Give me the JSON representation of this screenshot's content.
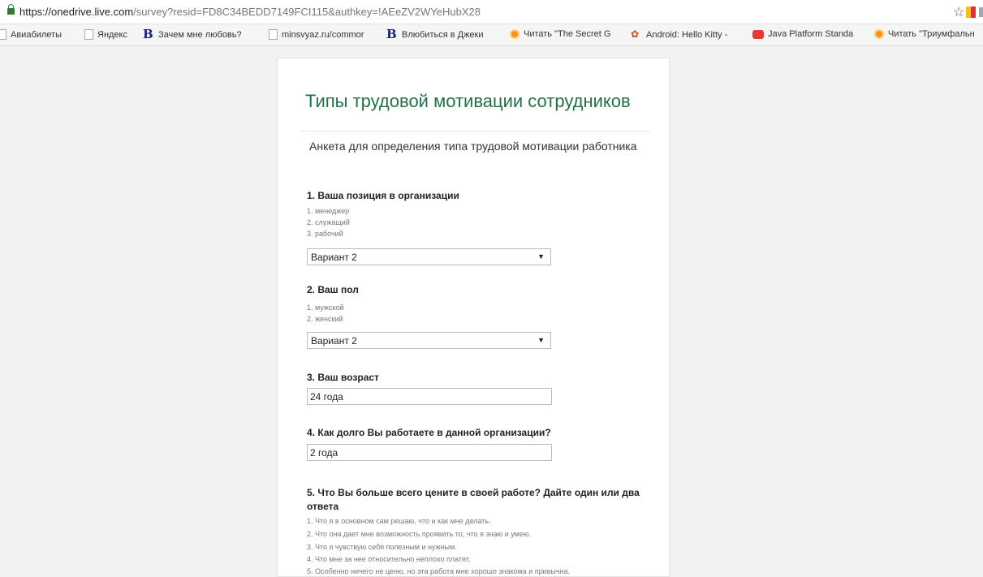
{
  "browser": {
    "url_host": "https://onedrive.live.com",
    "url_rest": "/survey?resid=FD8C34BEDD7149FCI115&authkey=!AEeZV2WYeHubX28",
    "bookmarks": [
      {
        "label": "Авиабилеты",
        "icon": "page-icon"
      },
      {
        "label": "Яндекс",
        "icon": "page-icon"
      },
      {
        "label": "Зачем мне любовь?",
        "icon": "b-icon"
      },
      {
        "label": "minsvyaz.ru/commor",
        "icon": "page-icon"
      },
      {
        "label": "Влюбиться в Джеки",
        "icon": "b-icon"
      },
      {
        "label": "Читать \"The Secret G",
        "icon": "orange-circle-icon"
      },
      {
        "label": "Android: Hello Kitty -",
        "icon": "paw-icon"
      },
      {
        "label": "Java Platform Standa",
        "icon": "java-icon"
      },
      {
        "label": "Читать \"Триумфальн",
        "icon": "orange-circle-icon"
      }
    ]
  },
  "survey": {
    "title": "Типы трудовой мотивации сотрудников",
    "subtitle": "Анкета для определения типа трудовой мотивации работника",
    "q1": {
      "label": "1. Ваша позиция в организации",
      "options": [
        "1. менеджер",
        "2. служащий",
        "3. рабочий"
      ],
      "selected": "Вариант 2"
    },
    "q2": {
      "label": "2. Ваш пол",
      "options": [
        "1. мужской",
        "2. женский"
      ],
      "selected": "Вариант 2"
    },
    "q3": {
      "label": "3. Ваш возраст",
      "value": "24 года"
    },
    "q4": {
      "label": "4. Как долго Вы работаете в данной организации?",
      "value": "2 года"
    },
    "q5": {
      "label": "5. Что Вы больше всего цените в своей работе? Дайте один или два ответа",
      "options": [
        "1. Что я в основном сам решаю, что и как мне делать.",
        "2. Что она дает мне возможность проявить то, что я знаю и умею.",
        "3. Что я чувствую себя полезным и нужным.",
        "4. Что мне за нее относительно неплохо платят.",
        "5. Особенно ничего не ценю, но эта работа мне хорошо знакома и привычна."
      ]
    }
  }
}
